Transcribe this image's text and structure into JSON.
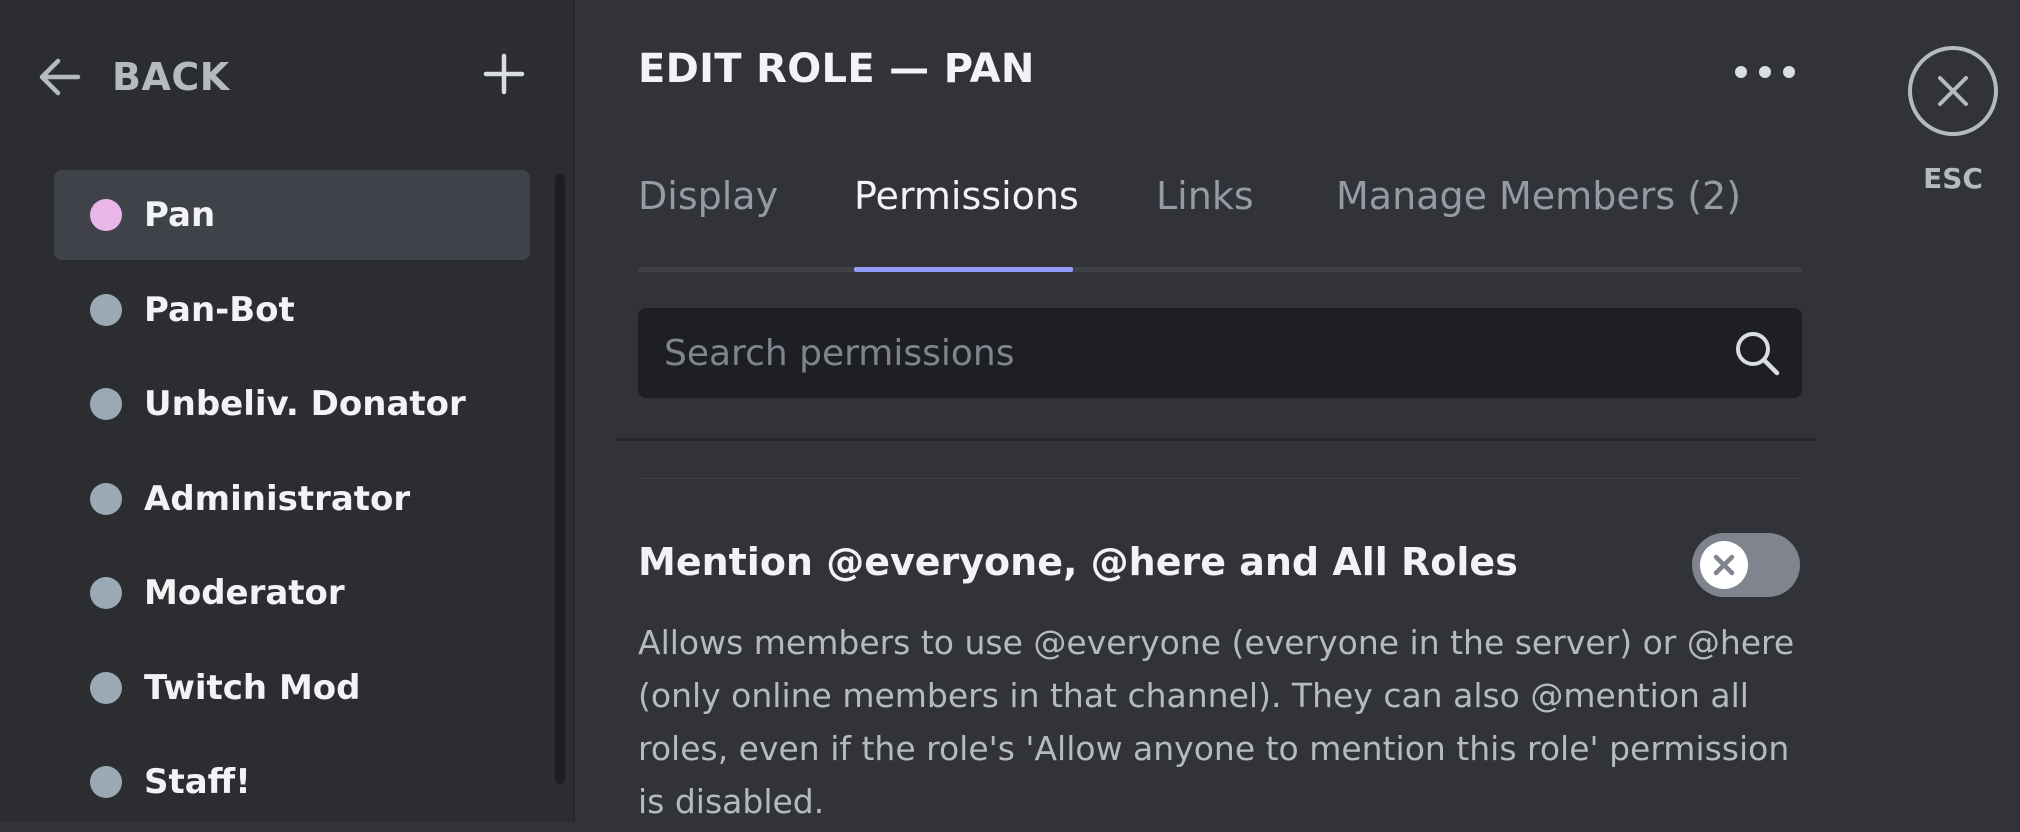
{
  "sidebar": {
    "back_label": "BACK",
    "roles": [
      {
        "name": "Pan",
        "color": "#e9b6ea",
        "selected": true
      },
      {
        "name": "Pan-Bot",
        "color": "#99aab5"
      },
      {
        "name": "Unbeliv. Donator",
        "color": "#99aab5"
      },
      {
        "name": "Administrator",
        "color": "#99aab5"
      },
      {
        "name": "Moderator",
        "color": "#99aab5"
      },
      {
        "name": "Twitch Mod",
        "color": "#99aab5"
      },
      {
        "name": "Staff!",
        "color": "#99aab5"
      }
    ]
  },
  "header": {
    "title": "EDIT ROLE — PAN"
  },
  "tabs": [
    {
      "label": "Display"
    },
    {
      "label": "Permissions",
      "active": true
    },
    {
      "label": "Links"
    },
    {
      "label": "Manage Members (2)"
    }
  ],
  "search": {
    "placeholder": "Search permissions",
    "value": ""
  },
  "permission": {
    "title": "Mention @everyone, @here and All Roles",
    "description": "Allows members to use @everyone (everyone in the server) or @here (only online members in that channel). They can also @mention all roles, even if the role's 'Allow anyone to mention this role' permission is disabled.",
    "enabled": false
  },
  "close": {
    "label": "ESC"
  },
  "colors": {
    "accent": "#949cf7",
    "background": "#313338",
    "sidebar": "#2b2d31",
    "toggle_off": "#80848e"
  },
  "icons": {
    "back": "arrow-left-icon",
    "add": "plus-icon",
    "more": "ellipsis-icon",
    "search": "search-icon",
    "close": "close-icon",
    "toggle": "x-icon"
  }
}
